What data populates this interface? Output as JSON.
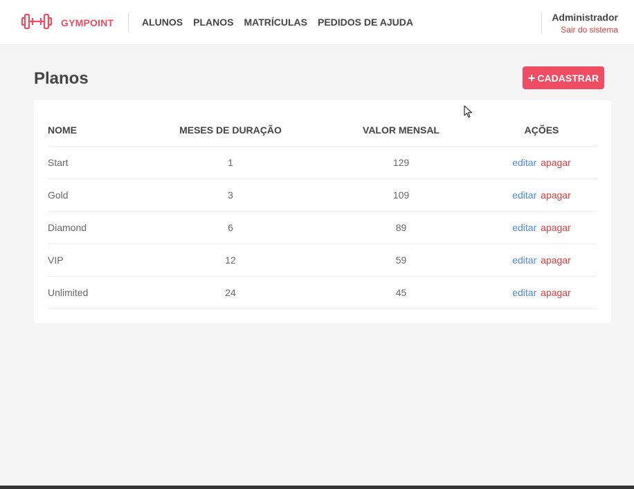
{
  "colors": {
    "brand": "#ee4d64",
    "edit_link": "#4d85ee",
    "delete_link": "#de3b3b",
    "background": "#f5f5f5"
  },
  "header": {
    "logo_icon": "dumbbell-icon",
    "brand_name": "GYMPOINT",
    "nav": [
      {
        "label": "ALUNOS"
      },
      {
        "label": "PLANOS"
      },
      {
        "label": "MATRÍCULAS"
      },
      {
        "label": "PEDIDOS DE AJUDA"
      }
    ],
    "user": {
      "name": "Administrador",
      "logout_label": "Sair do sistema"
    }
  },
  "main": {
    "title": "Planos",
    "add_button": {
      "icon": "plus-icon",
      "label": "CADASTRAR"
    },
    "table": {
      "columns": [
        "NOME",
        "MESES DE DURAÇÃO",
        "VALOR MENSAL",
        "AÇÕES"
      ],
      "rows": [
        {
          "name": "Start",
          "duration": "1",
          "price": "129",
          "edit": "editar",
          "delete": "apagar"
        },
        {
          "name": "Gold",
          "duration": "3",
          "price": "109",
          "edit": "editar",
          "delete": "apagar"
        },
        {
          "name": "Diamond",
          "duration": "6",
          "price": "89",
          "edit": "editar",
          "delete": "apagar"
        },
        {
          "name": "VIP",
          "duration": "12",
          "price": "59",
          "edit": "editar",
          "delete": "apagar"
        },
        {
          "name": "Unlimited",
          "duration": "24",
          "price": "45",
          "edit": "editar",
          "delete": "apagar"
        }
      ]
    }
  }
}
